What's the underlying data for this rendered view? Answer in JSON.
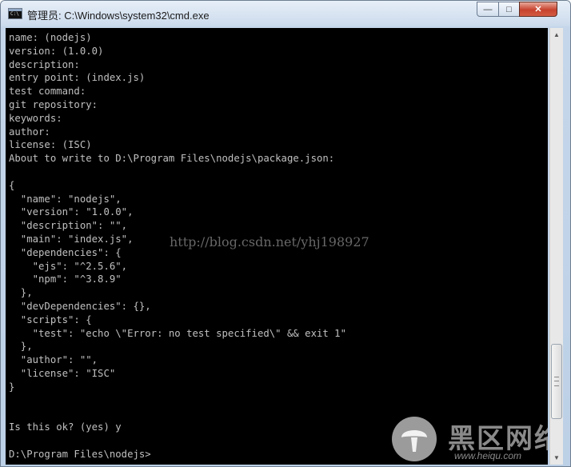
{
  "window": {
    "title": "管理员: C:\\Windows\\system32\\cmd.exe",
    "icon_label": "C:\\",
    "controls": {
      "minimize": "—",
      "maximize": "□",
      "close": "✕"
    }
  },
  "console": {
    "lines": [
      "name: (nodejs)",
      "version: (1.0.0)",
      "description:",
      "entry point: (index.js)",
      "test command:",
      "git repository:",
      "keywords:",
      "author:",
      "license: (ISC)",
      "About to write to D:\\Program Files\\nodejs\\package.json:",
      "",
      "{",
      "  \"name\": \"nodejs\",",
      "  \"version\": \"1.0.0\",",
      "  \"description\": \"\",",
      "  \"main\": \"index.js\",",
      "  \"dependencies\": {",
      "    \"ejs\": \"^2.5.6\",",
      "    \"npm\": \"^3.8.9\"",
      "  },",
      "  \"devDependencies\": {},",
      "  \"scripts\": {",
      "    \"test\": \"echo \\\"Error: no test specified\\\" && exit 1\"",
      "  },",
      "  \"author\": \"\",",
      "  \"license\": \"ISC\"",
      "}",
      "",
      "",
      "Is this ok? (yes) y",
      "",
      "D:\\Program Files\\nodejs>"
    ]
  },
  "watermark": {
    "text": "http://blog.csdn.net/yhj198927"
  },
  "brand": {
    "name": "黑区网络",
    "url": "www.heiqu.com"
  },
  "scrollbar": {
    "up": "▲",
    "down": "▼"
  }
}
